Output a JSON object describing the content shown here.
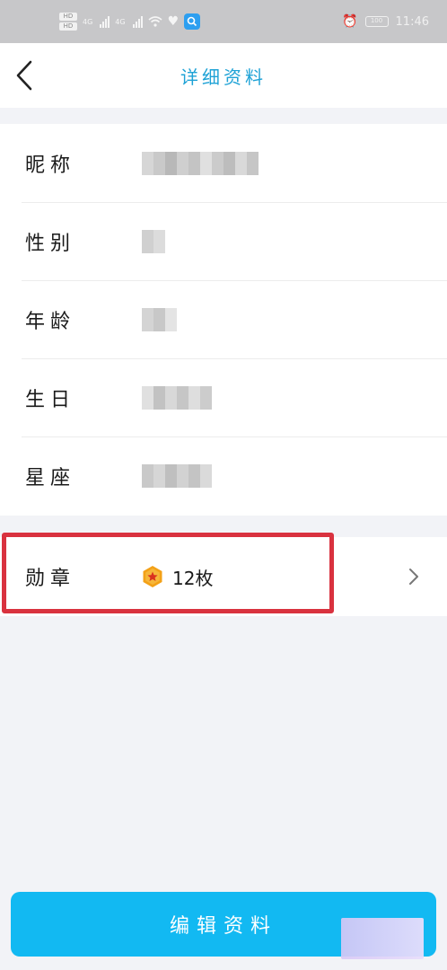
{
  "status_bar": {
    "hd_badges": [
      "HD",
      "HD"
    ],
    "network_labels": [
      "4G",
      "4G"
    ],
    "battery_text": "100",
    "time": "11:46"
  },
  "header": {
    "title": "详细资料",
    "back_icon": "chevron-left-icon"
  },
  "profile_fields": [
    {
      "label": "昵称",
      "value_redacted": true
    },
    {
      "label": "性别",
      "value_redacted": true
    },
    {
      "label": "年龄",
      "value_redacted": true
    },
    {
      "label": "生日",
      "value_redacted": true
    },
    {
      "label": "星座",
      "value_redacted": true
    }
  ],
  "badges": {
    "label": "勋章",
    "count_text": "12枚",
    "icon": "medal-star-icon",
    "chevron_icon": "chevron-right-icon"
  },
  "edit_button": {
    "label": "编辑资料"
  },
  "colors": {
    "accent": "#1ea2d6",
    "button": "#12b9f2",
    "highlight": "#d9323f",
    "medal": "#f3a117"
  }
}
